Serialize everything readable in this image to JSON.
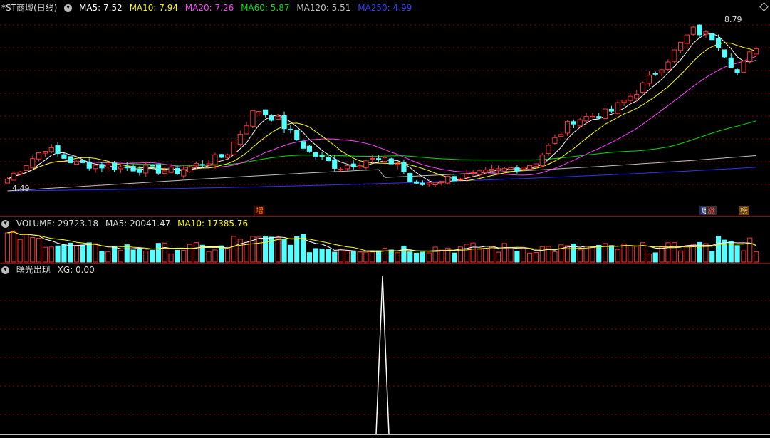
{
  "main_header": {
    "title": "*ST商城(日线)",
    "ma5": "MA5: 7.52",
    "ma10": "MA10: 7.94",
    "ma20": "MA20: 7.26",
    "ma60": "MA60: 5.87",
    "ma120": "MA120: 5.51",
    "ma250": "MA250: 4.99"
  },
  "price_labels": {
    "high": "8.79",
    "low": "4.49"
  },
  "event_tags": [
    "增",
    "账",
    "涨",
    "榜"
  ],
  "volume_header": {
    "title": "VOLUME: 29723.18",
    "ma5": "MA5: 20041.47",
    "ma10": "MA10: 17385.76"
  },
  "indicator_header": {
    "title": "曙光出现",
    "xg": "XG: 0.00"
  },
  "colors": {
    "up": "#ff3232",
    "down": "#54ffff",
    "ma5": "#ffffff",
    "ma10": "#ffff00",
    "ma20": "#ff40ff",
    "ma60": "#00e000",
    "ma120": "#c0c0c0",
    "ma250": "#3030ff",
    "grid": "#8a0000"
  },
  "chart_data": {
    "type": "candlestick",
    "price_range": [
      4.49,
      8.79
    ],
    "candle_count": 120,
    "indicator_signal": {
      "type": "XG",
      "value_at_peak": 1,
      "current": 0.0
    }
  }
}
